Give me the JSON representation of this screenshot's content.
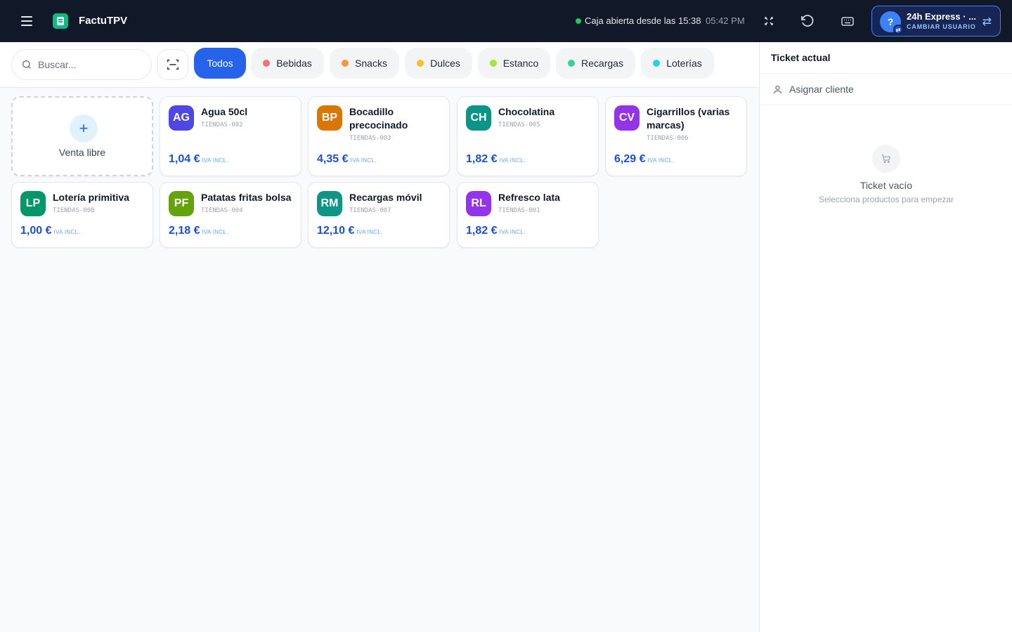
{
  "header": {
    "app_title": "FactuTPV",
    "status_text": "Caja abierta desde las 15:38",
    "clock": "05:42 PM",
    "user": {
      "avatar": "?",
      "name": "24h Express · ...",
      "action": "CAMBIAR USUARIO"
    }
  },
  "filters": {
    "search_placeholder": "Buscar...",
    "categories": [
      {
        "label": "Todos",
        "active": true
      },
      {
        "label": "Bebidas",
        "color": "#f87171"
      },
      {
        "label": "Snacks",
        "color": "#fb923c"
      },
      {
        "label": "Dulces",
        "color": "#fbbf24"
      },
      {
        "label": "Estanco",
        "color": "#a3e635"
      },
      {
        "label": "Recargas",
        "color": "#34d399"
      },
      {
        "label": "Loterías",
        "color": "#22d3ee"
      }
    ]
  },
  "free_sale": {
    "label": "Venta libre"
  },
  "iva_label": "IVA INCL.",
  "products": [
    {
      "initials": "AG",
      "name": "Agua 50cl",
      "sku": "TIENDAS-002",
      "price": "1,04 €",
      "color": "#4f46e5"
    },
    {
      "initials": "BP",
      "name": "Bocadillo precocinado",
      "sku": "TIENDAS-003",
      "price": "4,35 €",
      "color": "#d97706"
    },
    {
      "initials": "CH",
      "name": "Chocolatina",
      "sku": "TIENDAS-005",
      "price": "1,82 €",
      "color": "#0d9488"
    },
    {
      "initials": "CV",
      "name": "Cigarrillos (varias marcas)",
      "sku": "TIENDAS-006",
      "price": "6,29 €",
      "color": "#9333ea"
    },
    {
      "initials": "LP",
      "name": "Lotería primitiva",
      "sku": "TIENDAS-008",
      "price": "1,00 €",
      "color": "#059669"
    },
    {
      "initials": "PF",
      "name": "Patatas fritas bolsa",
      "sku": "TIENDAS-004",
      "price": "2,18 €",
      "color": "#65a30d"
    },
    {
      "initials": "RM",
      "name": "Recargas móvil",
      "sku": "TIENDAS-007",
      "price": "12,10 €",
      "color": "#0f9488"
    },
    {
      "initials": "RL",
      "name": "Refresco lata",
      "sku": "TIENDAS-001",
      "price": "1,82 €",
      "color": "#9333ea"
    }
  ],
  "ticket": {
    "title": "Ticket actual",
    "assign_client": "Asignar cliente",
    "empty_title": "Ticket vacío",
    "empty_subtitle": "Selecciona productos para empezar"
  }
}
